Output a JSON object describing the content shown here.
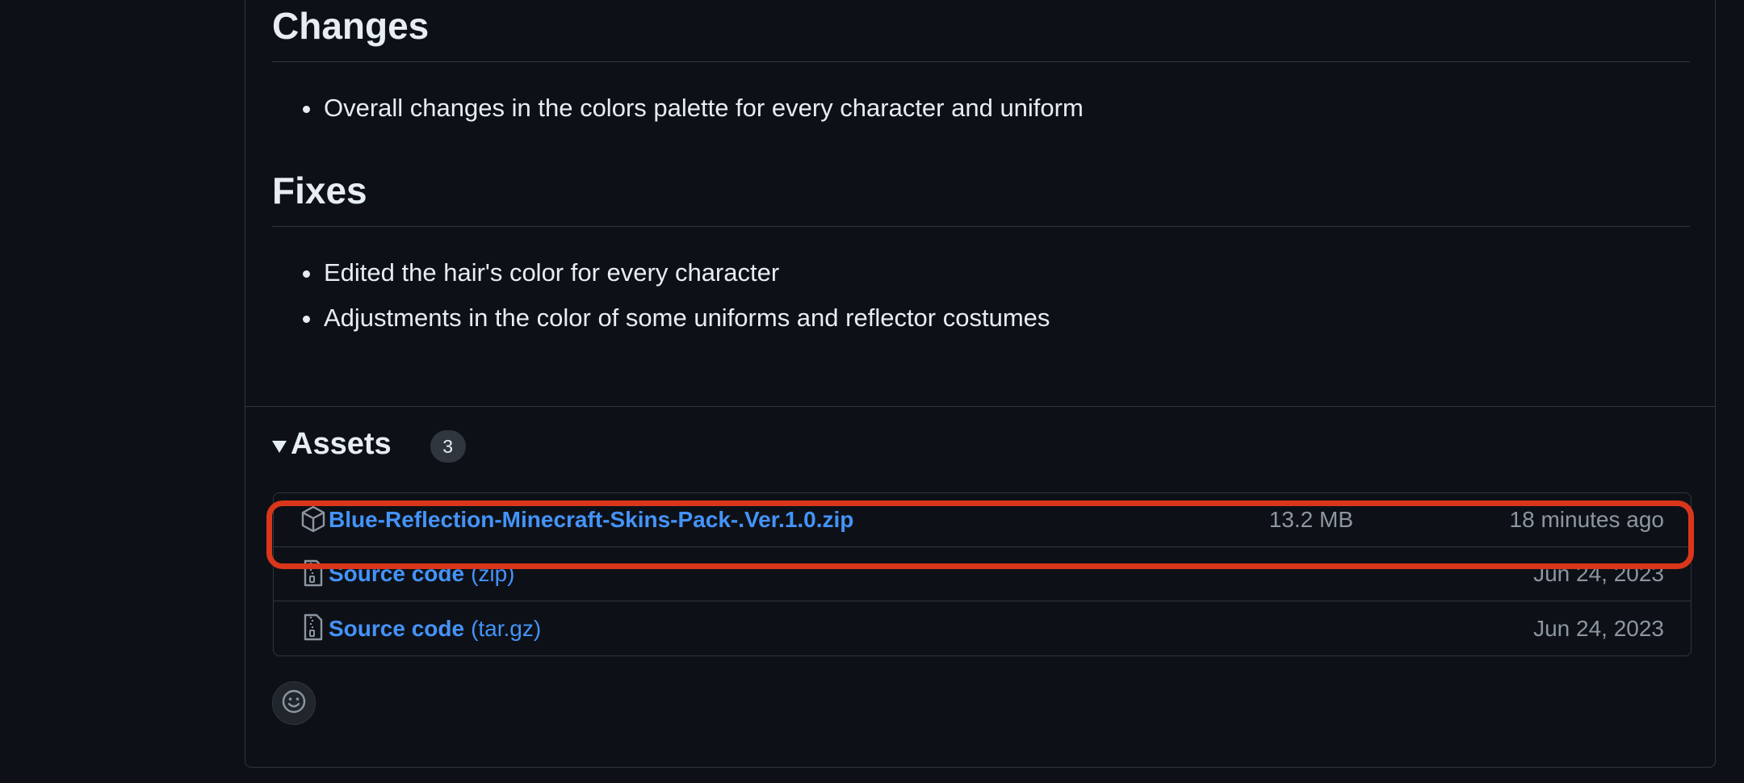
{
  "release_body": {
    "changes": {
      "heading": "Changes",
      "items": [
        "Overall changes in the colors palette for every character and uniform"
      ]
    },
    "fixes": {
      "heading": "Fixes",
      "items": [
        "Edited the hair's color for every character",
        "Adjustments in the color of some uniforms and reflector costumes"
      ]
    }
  },
  "assets": {
    "title": "Assets",
    "count": "3",
    "items": [
      {
        "icon": "package-icon",
        "name": "Blue-Reflection-Minecraft-Skins-Pack-.Ver.1.0.zip",
        "suffix": "",
        "size": "13.2 MB",
        "date": "18 minutes ago",
        "highlighted": true
      },
      {
        "icon": "file-zip-icon",
        "name": "Source code",
        "suffix": "(zip)",
        "size": "",
        "date": "Jun 24, 2023"
      },
      {
        "icon": "file-zip-icon",
        "name": "Source code",
        "suffix": "(tar.gz)",
        "size": "",
        "date": "Jun 24, 2023"
      }
    ]
  },
  "colors": {
    "background": "#0d1117",
    "border": "#30363d",
    "link": "#4493f8",
    "muted": "#8d96a0",
    "highlight": "#d9361b"
  }
}
